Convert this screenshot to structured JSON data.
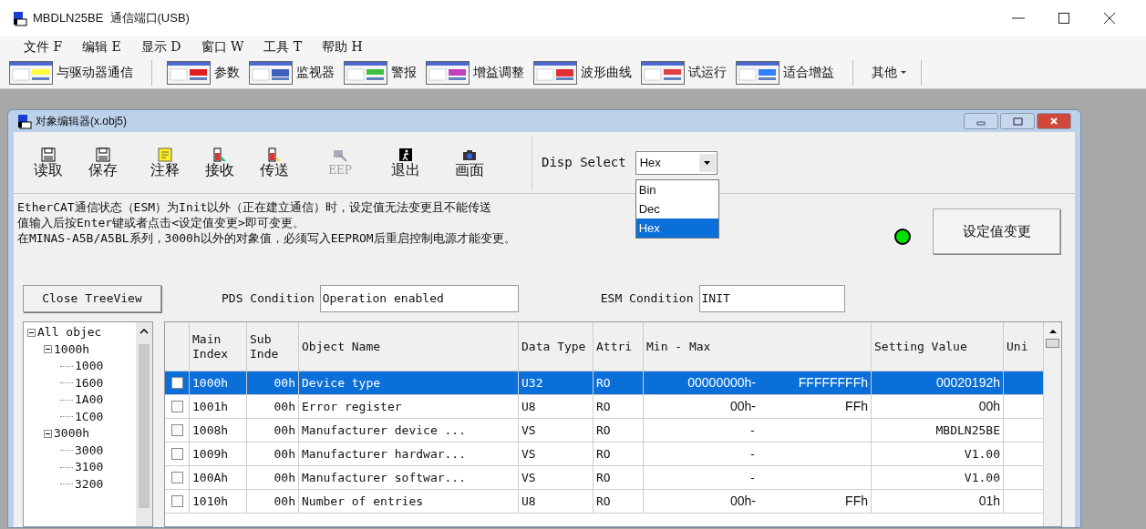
{
  "window": {
    "title": "MBDLN25BE  通信端口(USB)"
  },
  "menu": [
    "文件 F",
    "编辑 E",
    "显示 D",
    "窗口 W",
    "工具 T",
    "帮助 H"
  ],
  "toolbar": [
    {
      "label": "与驱动器通信",
      "kind": "button"
    },
    {
      "label": "参数",
      "kind": "button"
    },
    {
      "label": "监视器",
      "kind": "button"
    },
    {
      "label": "警报",
      "kind": "button"
    },
    {
      "label": "增益调整",
      "kind": "button"
    },
    {
      "label": "波形曲线",
      "kind": "button"
    },
    {
      "label": "试运行",
      "kind": "button"
    },
    {
      "label": "适合增益",
      "kind": "button"
    },
    {
      "label": "其他",
      "kind": "dropdown"
    }
  ],
  "editor": {
    "title": "对象编辑器(x.obj5)",
    "tools": [
      {
        "label": "读取",
        "disabled": false
      },
      {
        "label": "保存",
        "disabled": false
      },
      {
        "label": "注释",
        "disabled": false
      },
      {
        "label": "接收",
        "disabled": false
      },
      {
        "label": "传送",
        "disabled": false
      },
      {
        "label": "EEP",
        "disabled": true
      },
      {
        "label": "退出",
        "disabled": false
      },
      {
        "label": "画面",
        "disabled": false
      }
    ],
    "disp_select": {
      "label": "Disp Select",
      "value": "Hex",
      "options": [
        {
          "label": "Bin",
          "selected": false
        },
        {
          "label": "Dec",
          "selected": false
        },
        {
          "label": "Hex",
          "selected": true
        }
      ]
    },
    "messages": [
      "EtherCAT通信状态（ESM）为Init以外（正在建立通信）时，设定值无法变更且不能传送",
      "值输入后按Enter键或者点击<设定值变更>即可变更。",
      "在MINAS-A5B/A5BL系列，3000h以外的对象值，必须写入EEPROM后重启控制电源才能变更。"
    ],
    "status_lamp": {
      "color": "#00e000"
    },
    "apply_button": "设定值变更",
    "close_tree_button": "Close TreeView",
    "pds_condition": {
      "label": "PDS Condition",
      "value": "Operation enabled"
    },
    "esm_condition": {
      "label": "ESM Condition",
      "value": "INIT"
    },
    "tree": [
      {
        "label": "All objec",
        "expanded": true,
        "children": [
          {
            "label": "1000h",
            "expanded": true,
            "children": [
              {
                "label": "1000"
              },
              {
                "label": "1600"
              },
              {
                "label": "1A00"
              },
              {
                "label": "1C00"
              }
            ]
          },
          {
            "label": "3000h",
            "expanded": true,
            "children": [
              {
                "label": "3000"
              },
              {
                "label": "3100"
              },
              {
                "label": "3200"
              }
            ]
          }
        ]
      }
    ],
    "table": {
      "columns": [
        "Main Index",
        "Sub Inde",
        "Object Name",
        "Data Type",
        "Attri",
        "Min - Max",
        "Setting Value",
        "Uni"
      ],
      "rows": [
        {
          "selected": true,
          "checked": false,
          "main_index": "1000h",
          "sub_index": "00h",
          "object_name": "Device type",
          "data_type": "U32",
          "attri": "RO",
          "min": "00000000h-",
          "max": "FFFFFFFFh",
          "setting_value": "00020192h"
        },
        {
          "selected": false,
          "checked": false,
          "main_index": "1001h",
          "sub_index": "00h",
          "object_name": "Error register",
          "data_type": "U8",
          "attri": "RO",
          "min": "00h-",
          "max": "FFh",
          "setting_value": "00h"
        },
        {
          "selected": false,
          "checked": false,
          "main_index": "1008h",
          "sub_index": "00h",
          "object_name": "Manufacturer device ...",
          "data_type": "VS",
          "attri": "RO",
          "min": "-",
          "setting_value": "MBDLN25BE"
        },
        {
          "selected": false,
          "checked": false,
          "main_index": "1009h",
          "sub_index": "00h",
          "object_name": "Manufacturer hardwar...",
          "data_type": "VS",
          "attri": "RO",
          "min": "-",
          "setting_value": "V1.00"
        },
        {
          "selected": false,
          "checked": false,
          "main_index": "100Ah",
          "sub_index": "00h",
          "object_name": "Manufacturer softwar...",
          "data_type": "VS",
          "attri": "RO",
          "min": "-",
          "setting_value": "V1.00"
        },
        {
          "selected": false,
          "checked": false,
          "main_index": "1010h",
          "sub_index": "00h",
          "object_name": "Number of entries",
          "data_type": "U8",
          "attri": "RO",
          "min": "00h-",
          "max": "FFh",
          "setting_value": "01h"
        }
      ]
    }
  }
}
